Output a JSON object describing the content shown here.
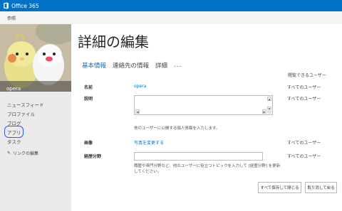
{
  "app": {
    "title": "Office 365",
    "brand_color": "#0072c6"
  },
  "subbar": {
    "reference": "参照"
  },
  "profile": {
    "name": "opera"
  },
  "nav": {
    "items": [
      "ニュースフィード",
      "プロファイル",
      "ブログ",
      "アプリ",
      "タスク"
    ],
    "edit_links": "リンクの編集",
    "edit_icon": "pencil-icon"
  },
  "page": {
    "title": "詳細の編集"
  },
  "tabs": [
    "基本情報",
    "連絡先の情報",
    "詳細",
    "..."
  ],
  "columns": {
    "visibility": "閲覧できるユーザー"
  },
  "fields": {
    "name": {
      "label": "名前",
      "value": "opera",
      "visibility": "すべてのユーザー"
    },
    "description": {
      "label": "説明",
      "value": "",
      "hint": "他のユーザーに公開する個人情報を入力します。",
      "visibility": "すべてのユーザー"
    },
    "picture": {
      "label": "画像",
      "link": "写真を変更する",
      "visibility": "すべてのユーザー"
    },
    "expertise": {
      "label": "経歴分野",
      "value": "",
      "hint_line1": "職歴や専門分野など、他のユーザーに役立つトピックを入力して [経歴分野] を更新",
      "hint_line2": "してください。",
      "visibility": "すべてのユーザー"
    }
  },
  "buttons": {
    "save_close": "すべて保存して閉じる",
    "cancel": "取り消して戻る"
  }
}
